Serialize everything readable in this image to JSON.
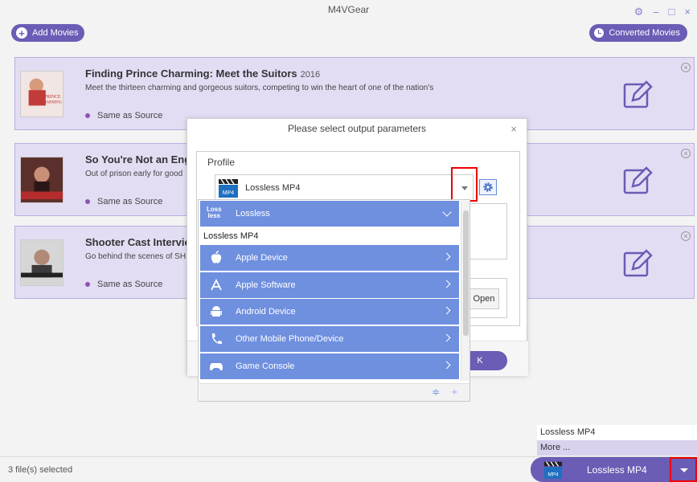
{
  "app": {
    "title": "M4VGear"
  },
  "toolbar": {
    "add_movies": "Add Movies",
    "converted_movies": "Converted Movies"
  },
  "window_controls": {
    "settings": "⚙",
    "minimize": "–",
    "maximize": "□",
    "close": "×"
  },
  "movies": [
    {
      "title": "Finding Prince Charming: Meet the Suitors",
      "year": "2016",
      "description": "Meet the thirteen charming and gorgeous suitors, competing to win the heart of one of the nation's",
      "output": "Same as Source"
    },
    {
      "title": "So You're Not an Eng",
      "year": "",
      "description": "Out of prison early for good",
      "output": "Same as Source"
    },
    {
      "title": "Shooter Cast Intervie",
      "year": "",
      "description": "Go behind the scenes of SH",
      "output": "Same as Source"
    }
  ],
  "dialog": {
    "title": "Please select output parameters",
    "close": "×",
    "profile_label": "Profile",
    "profile_value": "Lossless MP4",
    "open_button": "Open",
    "ok_button": "K"
  },
  "dropdown": {
    "header": {
      "icon_text_1": "Loss",
      "icon_text_2": "less",
      "label": "Lossless"
    },
    "selected_option": "Lossless MP4",
    "categories": [
      {
        "label": "Apple Device",
        "icon": "apple-icon"
      },
      {
        "label": "Apple Software",
        "icon": "app-store-icon"
      },
      {
        "label": "Android Device",
        "icon": "android-icon"
      },
      {
        "label": "Other Mobile Phone/Device",
        "icon": "phone-icon"
      },
      {
        "label": "Game Console",
        "icon": "gamepad-icon"
      }
    ]
  },
  "format_menu": {
    "options": [
      "Lossless MP4",
      "More ..."
    ]
  },
  "format_bar": {
    "label": "Lossless MP4"
  },
  "status": {
    "selection": "3 file(s) selected"
  },
  "colors": {
    "accent": "#6b5cb5",
    "card_bg": "#e3ddf4",
    "dropdown_blue": "#6f8fdf",
    "highlight": "#ee0000"
  }
}
